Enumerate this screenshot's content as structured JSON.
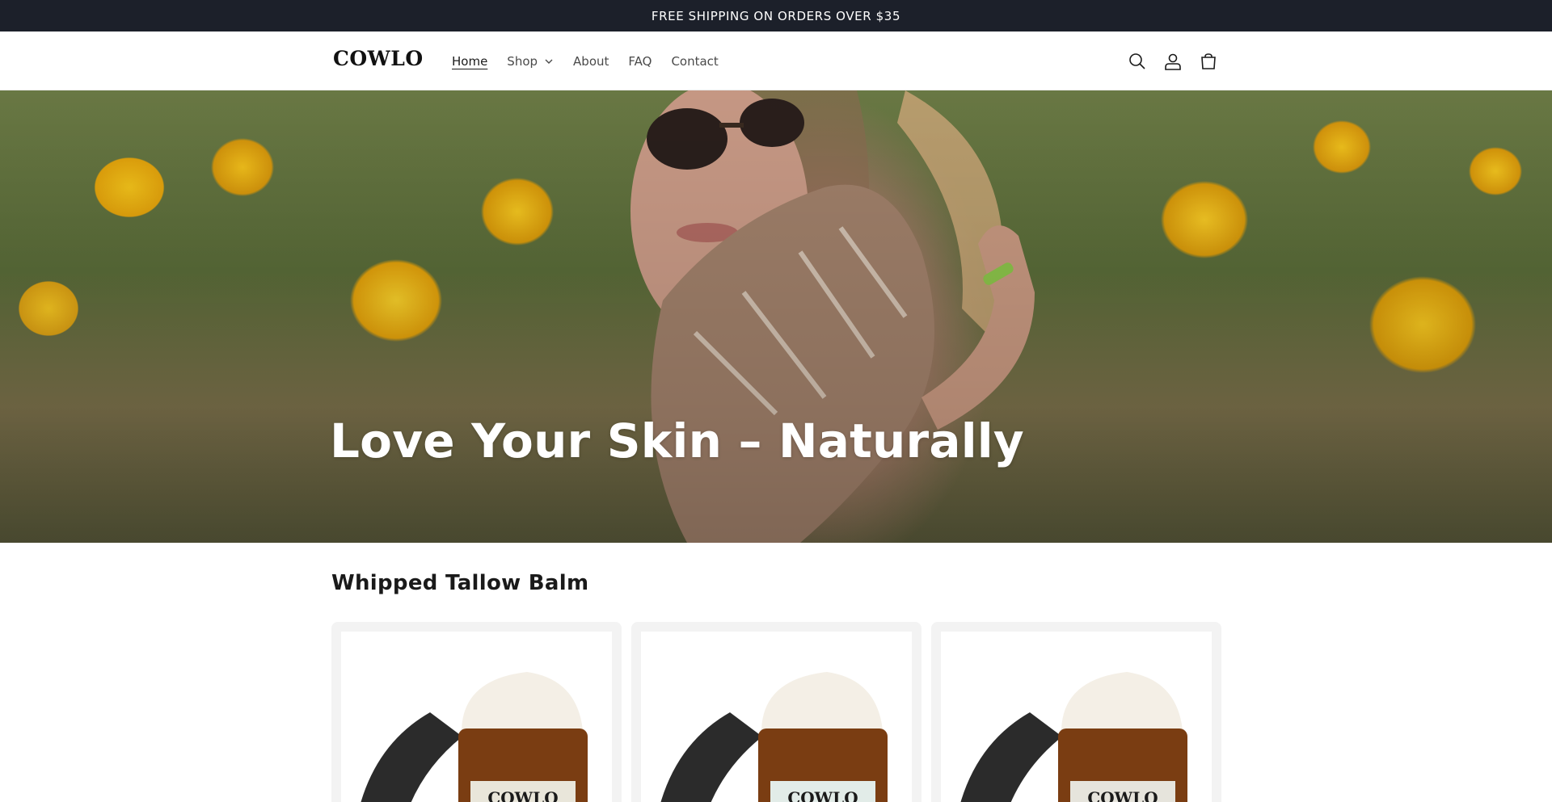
{
  "announcement": {
    "text": "FREE SHIPPING ON ORDERS OVER $35"
  },
  "header": {
    "logo": "COWLO",
    "nav": [
      {
        "label": "Home",
        "active": true
      },
      {
        "label": "Shop",
        "has_dropdown": true
      },
      {
        "label": "About"
      },
      {
        "label": "FAQ"
      },
      {
        "label": "Contact"
      }
    ],
    "icons": [
      "search-icon",
      "account-icon",
      "cart-icon"
    ]
  },
  "hero": {
    "title": "Love Your Skin – Naturally"
  },
  "collection": {
    "title": "Whipped Tallow Balm",
    "products": [
      {
        "jar_label": "COWLO"
      },
      {
        "jar_label": "COWLO"
      },
      {
        "jar_label": "COWLO"
      }
    ]
  },
  "colors": {
    "announcement_bg": "#1c202a",
    "card_bg": "#f3f3f3",
    "jar_amber": "#7a3d12"
  }
}
